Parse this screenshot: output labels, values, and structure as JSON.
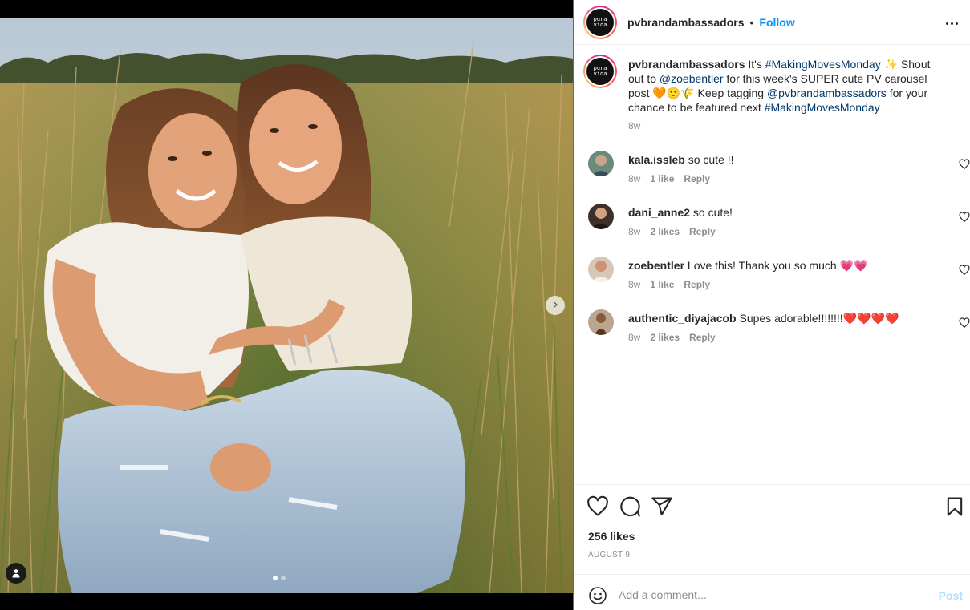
{
  "post": {
    "username": "pvbrandambassadors",
    "separator": "•",
    "follow_label": "Follow",
    "avatar_text_line1": "pura",
    "avatar_text_line2": "vida"
  },
  "caption": {
    "username": "pvbrandambassadors",
    "part1": " It's ",
    "hashtag1": "#MakingMovesMonday",
    "part2": " ✨ Shout out to ",
    "mention1": "@zoebentler",
    "part3": " for this week's SUPER cute PV carousel post 🧡🙂🌾 Keep tagging ",
    "mention2": "@pvbrandambassadors",
    "part4": " for your chance to be featured next ",
    "hashtag2": "#MakingMovesMonday",
    "time": "8w"
  },
  "comments": [
    {
      "username": "kala.issleb",
      "text": "so cute !!",
      "emoji": "",
      "time": "8w",
      "likes": "1 like",
      "reply": "Reply"
    },
    {
      "username": "dani_anne2",
      "text": "so cute!",
      "emoji": "",
      "time": "8w",
      "likes": "2 likes",
      "reply": "Reply"
    },
    {
      "username": "zoebentler",
      "text": "Love this! Thank you so much",
      "emoji": "💗💗",
      "time": "8w",
      "likes": "1 like",
      "reply": "Reply"
    },
    {
      "username": "authentic_diyajacob",
      "text": "Supes adorable!!!!!!!!",
      "emoji": "❤️❤️❤️❤️",
      "time": "8w",
      "likes": "2 likes",
      "reply": "Reply"
    }
  ],
  "stats": {
    "likes": "256 likes",
    "date": "AUGUST 9"
  },
  "comment_box": {
    "placeholder": "Add a comment...",
    "post_label": "Post"
  },
  "icons": {
    "like": "heart-icon",
    "comment": "comment-icon",
    "share": "share-icon",
    "save": "bookmark-icon",
    "emoji": "emoji-icon",
    "more": "more-options-icon",
    "next": "chevron-right-icon",
    "tags": "user-tag-icon"
  },
  "colors": {
    "accent_blue": "#0095f6",
    "link": "#00376b",
    "muted": "#8e8e8e",
    "post_disabled": "#b2dffc"
  }
}
